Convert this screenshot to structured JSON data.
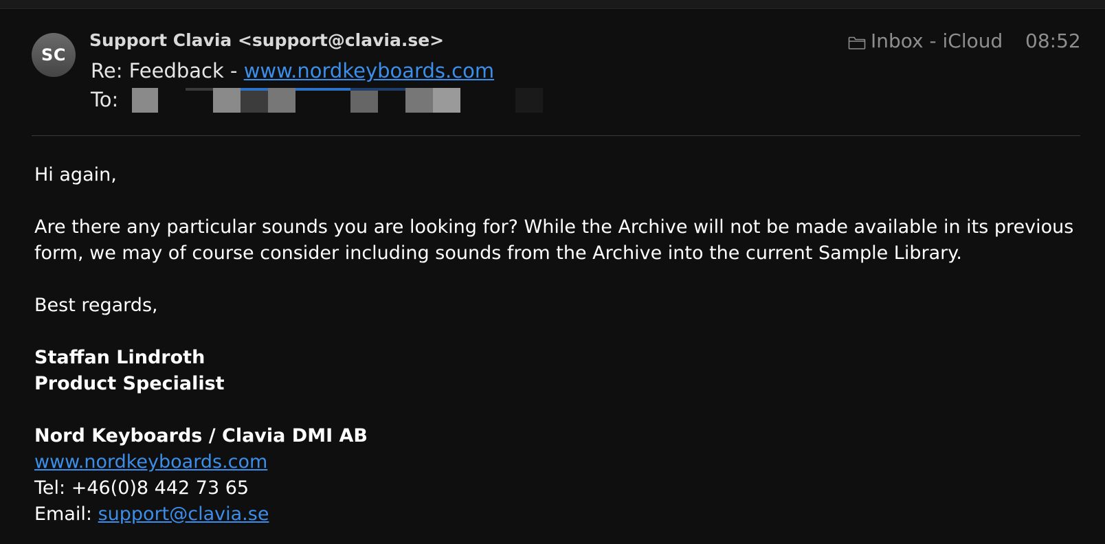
{
  "header": {
    "avatar_initials": "SC",
    "from": "Support Clavia <support@clavia.se>",
    "subject_prefix": "Re: Feedback - ",
    "subject_link": "www.nordkeyboards.com",
    "to_label": "To:",
    "mailbox": "Inbox - iCloud",
    "time": "08:52",
    "folder_icon": "folder-icon"
  },
  "body": {
    "greeting": "Hi again,",
    "paragraph_line1": "Are there any particular sounds you are looking for? While the Archive will not be made available in its previous",
    "paragraph_line2": "form, we may of course consider including sounds from the Archive into the current Sample Library.",
    "closing": "Best regards,",
    "sender_name": "Staffan Lindroth",
    "sender_title": "Product Specialist",
    "company": "Nord Keyboards / Clavia DMI AB",
    "website": "www.nordkeyboards.com",
    "tel": "Tel: +46(0)8 442 73 65",
    "email_label": "Email: ",
    "email": "support@clavia.se"
  },
  "colors": {
    "background": "#0f0f0f",
    "link": "#3b8eea",
    "muted": "#8e8e8e"
  }
}
